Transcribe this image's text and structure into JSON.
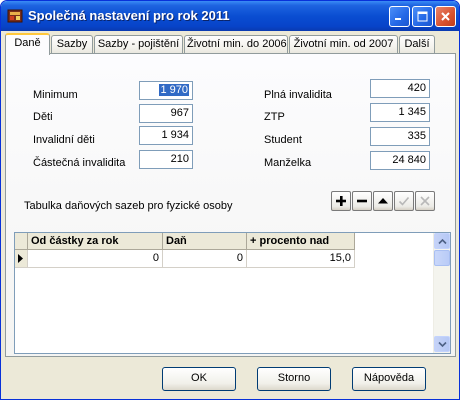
{
  "window": {
    "title": "Společná nastavení pro rok 2011"
  },
  "tabs": [
    {
      "label": "Daně",
      "active": true
    },
    {
      "label": "Sazby"
    },
    {
      "label": "Sazby - pojištění"
    },
    {
      "label": "Životní min. do 2006"
    },
    {
      "label": "Životní min. od 2007"
    },
    {
      "label": "Další"
    }
  ],
  "left_fields": [
    {
      "label": "Minimum",
      "value": "1 970",
      "selected": true
    },
    {
      "label": "Děti",
      "value": "967"
    },
    {
      "label": "Invalidní děti",
      "value": "1 934"
    },
    {
      "label": "Částečná invalidita",
      "value": "210"
    }
  ],
  "right_fields": [
    {
      "label": "Plná invalidita",
      "value": "420"
    },
    {
      "label": "ZTP",
      "value": "1 345"
    },
    {
      "label": "Student",
      "value": "335"
    },
    {
      "label": "Manželka",
      "value": "24 840"
    }
  ],
  "table_caption": "Tabulka daňových sazeb pro fyzické osoby",
  "navigator": {
    "buttons": [
      "insert-icon",
      "delete-icon",
      "move-up-icon",
      "post-icon",
      "cancel-icon"
    ]
  },
  "grid": {
    "columns": [
      "Od částky za rok",
      "Daň",
      "+ procento nad"
    ],
    "rows": [
      [
        "0",
        "0",
        "15,0"
      ]
    ]
  },
  "buttons": {
    "ok": "OK",
    "cancel": "Storno",
    "help": "Nápověda"
  },
  "colors": {
    "titlebar": "#0a4ed2",
    "tab_highlight": "#ffc83c",
    "selection": "#316ac5",
    "window_bg": "#ece9d8"
  }
}
